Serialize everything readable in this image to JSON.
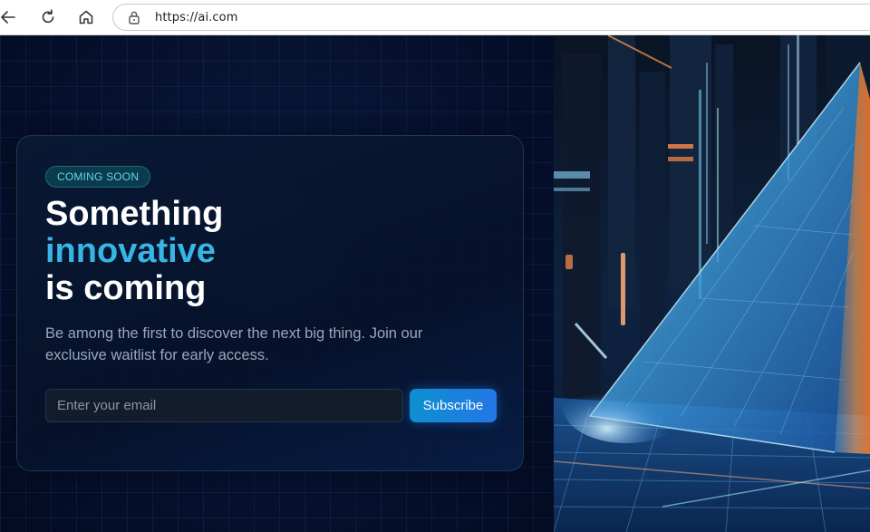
{
  "browser": {
    "url": "https://ai.com",
    "icons": {
      "back": "arrow-left-icon",
      "reload": "reload-icon",
      "home": "home-icon",
      "lock": "lock-icon"
    }
  },
  "hero": {
    "badge": "COMING SOON",
    "title_line1": "Something",
    "title_line2": "innovative",
    "title_line3": "is coming",
    "description": "Be among the first to discover the next big thing. Join our exclusive waitlist for early access.",
    "email_placeholder": "Enter your email",
    "subscribe_label": "Subscribe"
  },
  "colors": {
    "accent": "#37b6e6",
    "button": "#1a84db",
    "background": "#040c20"
  }
}
